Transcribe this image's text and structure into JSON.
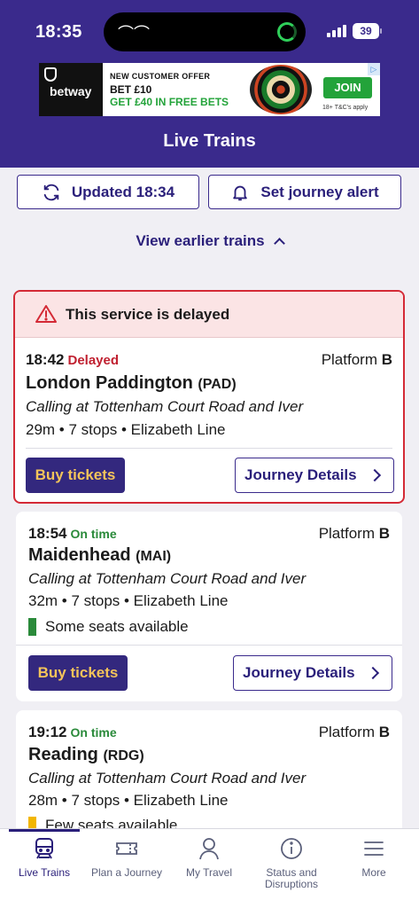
{
  "status_bar": {
    "time": "18:35",
    "battery": "39"
  },
  "ad": {
    "brand": "betway",
    "offer": "NEW CUSTOMER OFFER",
    "bet": "BET £10",
    "free": "GET £40 IN FREE BETS",
    "join": "JOIN",
    "terms": "18+ T&C's apply"
  },
  "header": {
    "title": "Live Trains"
  },
  "actions": {
    "updated": "Updated 18:34",
    "alert": "Set journey alert",
    "earlier": "View earlier trains"
  },
  "trains": [
    {
      "alert": "This service is delayed",
      "time": "18:42",
      "status": "Delayed",
      "platform_label": "Platform",
      "platform": "B",
      "destination": "London Paddington",
      "code": "(PAD)",
      "calling": "Calling at Tottenham Court Road and Iver",
      "meta": "29m • 7 stops • Elizabeth Line",
      "buy": "Buy tickets",
      "details": "Journey Details"
    },
    {
      "time": "18:54",
      "status": "On time",
      "platform_label": "Platform",
      "platform": "B",
      "destination": "Maidenhead",
      "code": "(MAI)",
      "calling": "Calling at Tottenham Court Road and Iver",
      "meta": "32m • 7 stops • Elizabeth Line",
      "seats": "Some seats available",
      "seats_color": "#2a8a3a",
      "buy": "Buy tickets",
      "details": "Journey Details"
    },
    {
      "time": "19:12",
      "status": "On time",
      "platform_label": "Platform",
      "platform": "B",
      "destination": "Reading",
      "code": "(RDG)",
      "calling": "Calling at Tottenham Court Road and Iver",
      "meta": "28m • 7 stops • Elizabeth Line",
      "seats": "Few seats available",
      "seats_color": "#f2b600"
    }
  ],
  "nav": [
    {
      "label": "Live Trains",
      "icon": "train-icon"
    },
    {
      "label": "Plan a Journey",
      "icon": "ticket-icon"
    },
    {
      "label": "My Travel",
      "icon": "person-icon"
    },
    {
      "label": "Status and Disruptions",
      "icon": "info-icon"
    },
    {
      "label": "More",
      "icon": "menu-icon"
    }
  ],
  "colors": {
    "brand": "#3a2a8c",
    "delayed": "#c02030",
    "on_time": "#2a8a3a",
    "buy_text": "#f4c45a"
  }
}
